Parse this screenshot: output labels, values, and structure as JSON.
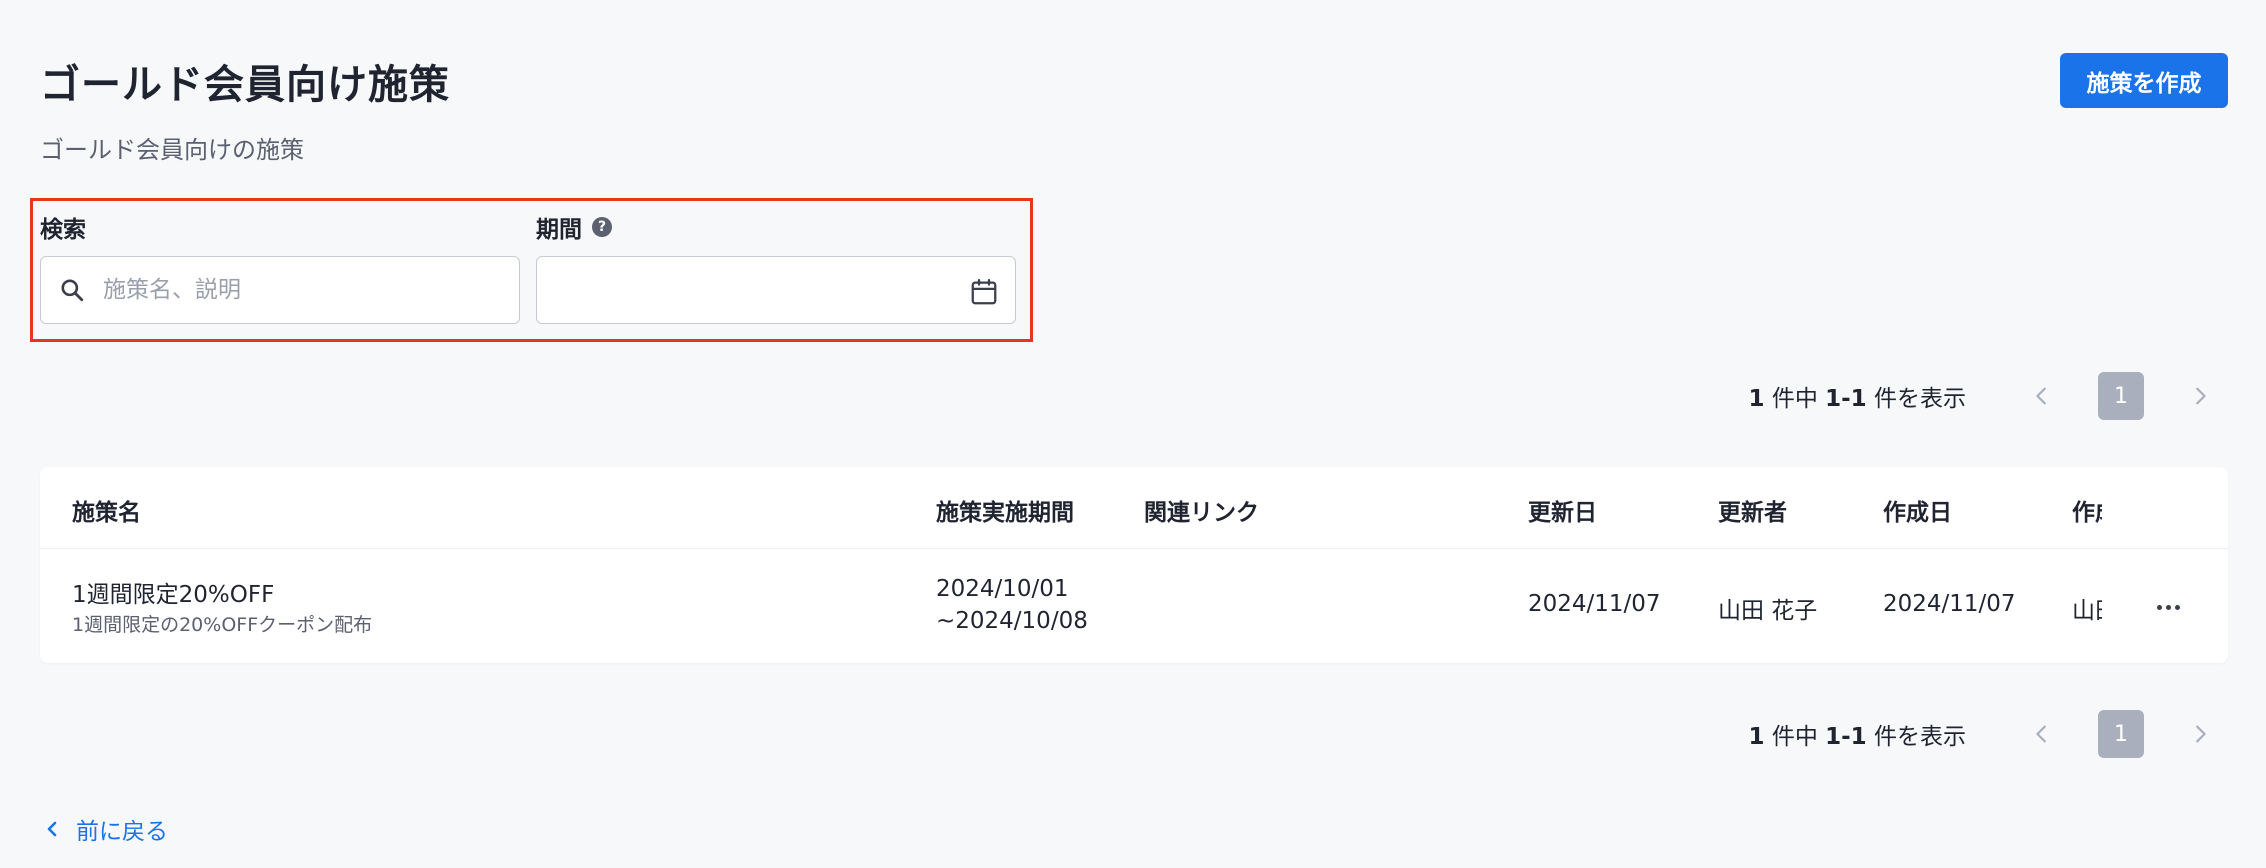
{
  "header": {
    "title": "ゴールド会員向け施策",
    "subtitle": "ゴールド会員向けの施策",
    "create_button": "施策を作成"
  },
  "filters": {
    "search_label": "検索",
    "search_placeholder": "施策名、説明",
    "search_value": "",
    "period_label": "期間",
    "period_value": ""
  },
  "pagination": {
    "total": "1",
    "summary_mid": "件中",
    "range": "1-1",
    "summary_end": "件を表示",
    "current_page": "1"
  },
  "table": {
    "columns": [
      "施策名",
      "施策実施期間",
      "関連リンク",
      "更新日",
      "更新者",
      "作成日",
      "作成者"
    ],
    "rows": [
      {
        "name": "1週間限定20%OFF",
        "description": "1週間限定の20%OFFクーポン配布",
        "period_start": "2024/10/01",
        "period_end": "~2024/10/08",
        "link": "",
        "updated_at": "2024/11/07",
        "updated_by": "山田 花子",
        "created_at": "2024/11/07",
        "created_by": "山田 花子"
      }
    ]
  },
  "footer": {
    "back_label": "前に戻る"
  },
  "colors": {
    "accent": "#1a73e8",
    "highlight_border": "#e5361f",
    "page_background": "#f7f8fa"
  },
  "icons": [
    "search-icon",
    "help-icon",
    "calendar-icon",
    "chevron-left-icon",
    "chevron-right-icon",
    "more-icon"
  ]
}
